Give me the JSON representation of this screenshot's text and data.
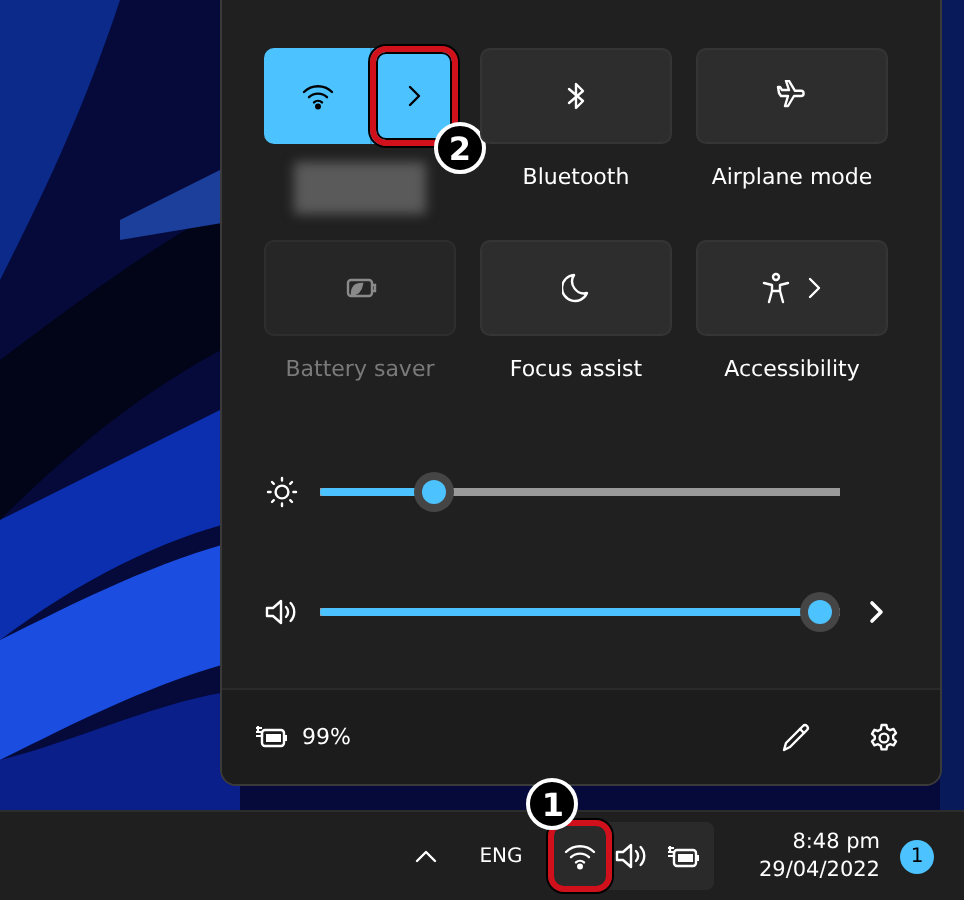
{
  "quick_settings": {
    "tiles": [
      {
        "kind": "split",
        "label_blurred": true,
        "on": true,
        "disabled": false,
        "callout": "2"
      },
      {
        "kind": "plain",
        "label": "Bluetooth",
        "on": false,
        "disabled": false
      },
      {
        "kind": "plain",
        "label": "Airplane mode",
        "on": false,
        "disabled": false
      },
      {
        "kind": "plain",
        "label": "Battery saver",
        "on": false,
        "disabled": true
      },
      {
        "kind": "plain",
        "label": "Focus assist",
        "on": false,
        "disabled": false
      },
      {
        "kind": "menu",
        "label": "Accessibility",
        "on": false,
        "disabled": false
      }
    ],
    "sliders": [
      {
        "kind": "brightness",
        "level": 0.22
      },
      {
        "kind": "volume",
        "level": 0.97
      }
    ],
    "footer": {
      "battery": "99%"
    }
  },
  "taskbar": {
    "language": "ENG",
    "tray": [
      {
        "kind": "wifi",
        "callout": "1"
      },
      {
        "kind": "volume"
      },
      {
        "kind": "battery"
      }
    ],
    "time": "8:48 pm",
    "date": "29/04/2022",
    "notifications": "1"
  }
}
